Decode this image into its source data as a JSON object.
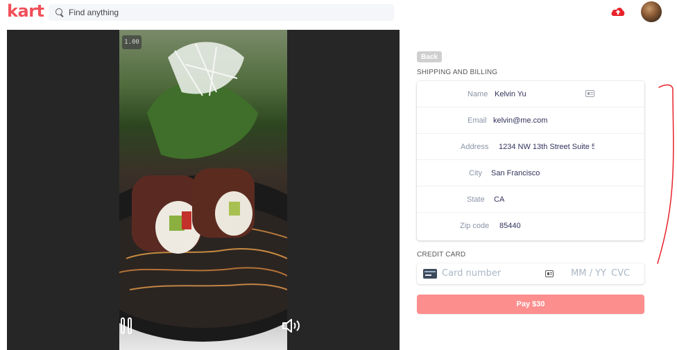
{
  "header": {
    "logo_text": "kart",
    "search_placeholder": "Find anything",
    "upload_icon": "cloud-upload-icon",
    "avatar_icon": "user-avatar"
  },
  "video": {
    "playback_rate": "1.00",
    "controls": [
      "pause-icon",
      "volume-icon"
    ]
  },
  "checkout": {
    "back_label": "Back",
    "shipping_title": "SHIPPING AND BILLING",
    "fields": [
      {
        "label": "Name",
        "value": "Kelvin Yu"
      },
      {
        "label": "Email",
        "value": "kelvin@me.com"
      },
      {
        "label": "Address",
        "value": "1234 NW 13th Street Suite 5"
      },
      {
        "label": "City",
        "value": "San Francisco"
      },
      {
        "label": "State",
        "value": "CA"
      },
      {
        "label": "Zip code",
        "value": "85440"
      }
    ],
    "credit_title": "CREDIT CARD",
    "card_number_placeholder": "Card number",
    "expiry_placeholder": "MM / YY",
    "cvc_placeholder": "CVC",
    "pay_label": "Pay $30"
  },
  "colors": {
    "brand": "#f0505a",
    "pay_button": "#fd8e8e",
    "annotation": "#e8222a",
    "field_value": "#32325d",
    "field_label": "#8a94a6"
  }
}
